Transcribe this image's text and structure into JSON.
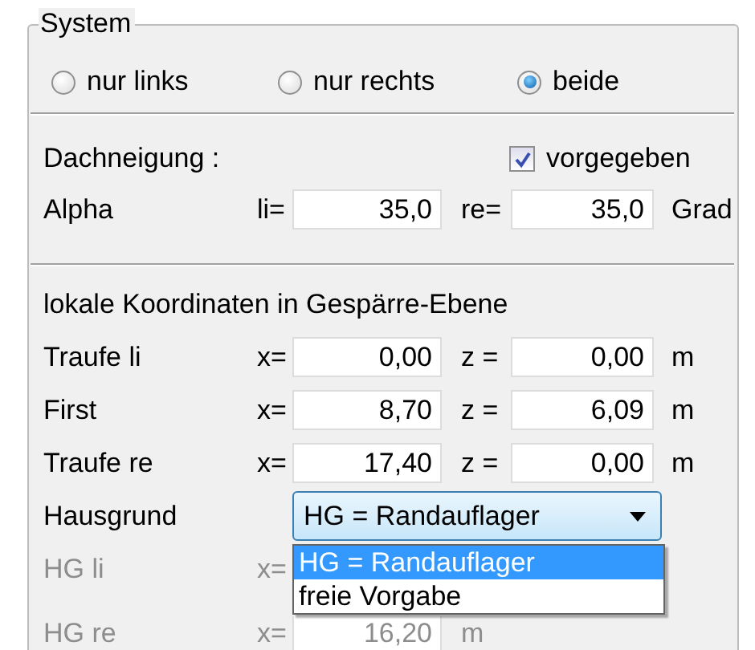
{
  "system": {
    "title": "System",
    "options": [
      {
        "label": "nur links",
        "selected": false
      },
      {
        "label": "nur rechts",
        "selected": false
      },
      {
        "label": "beide",
        "selected": true
      }
    ]
  },
  "roof_pitch": {
    "label": "Dachneigung :",
    "checkbox": {
      "label": "vorgegeben",
      "checked": true
    },
    "row": {
      "label": "Alpha",
      "prefix": "li=",
      "value_1": "35,0",
      "middle": "re=",
      "value_2": "35,0",
      "unit": "Grad"
    }
  },
  "coordinates": {
    "title": "lokale Koordinaten in Gespärre-Ebene",
    "rows": [
      {
        "kind": "coords",
        "label": "Traufe li",
        "prefix": "x=",
        "value_1": "0,00",
        "middle": "z =",
        "value_2": "0,00",
        "unit": "m",
        "disabled": false
      },
      {
        "kind": "coords",
        "label": "First",
        "prefix": "x=",
        "value_1": "8,70",
        "middle": "z =",
        "value_2": "6,09",
        "unit": "m",
        "disabled": false
      },
      {
        "kind": "coords",
        "label": "Traufe re",
        "prefix": "x=",
        "value_1": "17,40",
        "middle": "z =",
        "value_2": "0,00",
        "unit": "m",
        "disabled": false
      },
      {
        "kind": "select",
        "label": "Hausgrund",
        "value": "HG = Randauflager",
        "options": [
          {
            "label": "HG = Randauflager",
            "selected": true
          },
          {
            "label": "freie Vorgabe",
            "selected": false
          }
        ]
      },
      {
        "kind": "covered",
        "label": "HG li",
        "prefix": "x=",
        "disabled": true
      },
      {
        "kind": "partial",
        "label": "HG re",
        "prefix": "x=",
        "value_1": "16,20",
        "middle": "m",
        "disabled": true
      }
    ]
  }
}
